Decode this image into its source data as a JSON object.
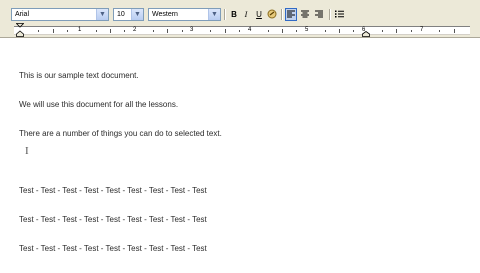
{
  "toolbar": {
    "font_name": "Arial",
    "font_size": "10",
    "script": "Western",
    "bold_label": "B",
    "italic_label": "I",
    "underline_label": "U"
  },
  "ruler": {
    "numbers": [
      "1",
      "2",
      "3",
      "4",
      "5",
      "6",
      "7"
    ]
  },
  "document": {
    "lines": [
      "This is our sample text document.",
      "We will use this document for all the lessons.",
      "There are a number of things you can do to selected text.",
      "",
      "Test - Test - Test - Test - Test - Test - Test - Test - Test",
      "Test - Test - Test - Test - Test - Test - Test - Test - Test",
      "Test - Test - Test - Test - Test - Test - Test - Test - Test"
    ]
  }
}
